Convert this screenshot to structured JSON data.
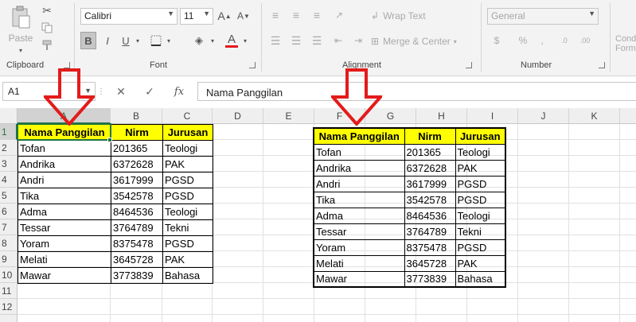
{
  "ribbon": {
    "clipboard": {
      "paste_label": "Paste",
      "group_label": "Clipboard"
    },
    "font": {
      "name": "Calibri",
      "size": "11",
      "bold_label": "B",
      "italic_label": "I",
      "underline_label": "U",
      "group_label": "Font"
    },
    "alignment": {
      "wrap_label": "Wrap Text",
      "merge_label": "Merge & Center",
      "group_label": "Alignment"
    },
    "number": {
      "format": "General",
      "group_label": "Number"
    },
    "styles": {
      "conditional_label_1": "Cond",
      "conditional_label_2": "Form"
    }
  },
  "formula_bar": {
    "name_box": "A1",
    "fx_label": "fx",
    "value": "Nama Panggilan"
  },
  "grid": {
    "columns": [
      "A",
      "B",
      "C",
      "D",
      "E",
      "F",
      "G",
      "H",
      "I",
      "J",
      "K"
    ],
    "rows": [
      "1",
      "2",
      "3",
      "4",
      "5",
      "6",
      "7",
      "8",
      "9",
      "10",
      "11",
      "12"
    ]
  },
  "table": {
    "headers": [
      "Nama Panggilan",
      "Nirm",
      "Jurusan"
    ],
    "rows": [
      [
        "Tofan",
        "201365",
        "Teologi"
      ],
      [
        "Andrika",
        "6372628",
        "PAK"
      ],
      [
        "Andri",
        "3617999",
        "PGSD"
      ],
      [
        "Tika",
        "3542578",
        "PGSD"
      ],
      [
        "Adma",
        "8464536",
        "Teologi"
      ],
      [
        "Tessar",
        "3764789",
        "Tekni"
      ],
      [
        "Yoram",
        "8375478",
        "PGSD"
      ],
      [
        "Melati",
        "3645728",
        "PAK"
      ],
      [
        "Mawar",
        "3773839",
        "Bahasa"
      ]
    ]
  },
  "colors": {
    "header_fill": "#ffff00",
    "accent": "#217346",
    "arrow": "#e31b1b"
  },
  "icons": [
    "cut-icon",
    "copy-icon",
    "format-painter-icon",
    "grow-font-icon",
    "shrink-font-icon",
    "border-icon",
    "fill-color-icon",
    "font-color-icon",
    "align-icon",
    "orientation-icon",
    "indent-icon",
    "cancel-icon",
    "enter-icon",
    "function-icon",
    "down-arrow-icon"
  ]
}
